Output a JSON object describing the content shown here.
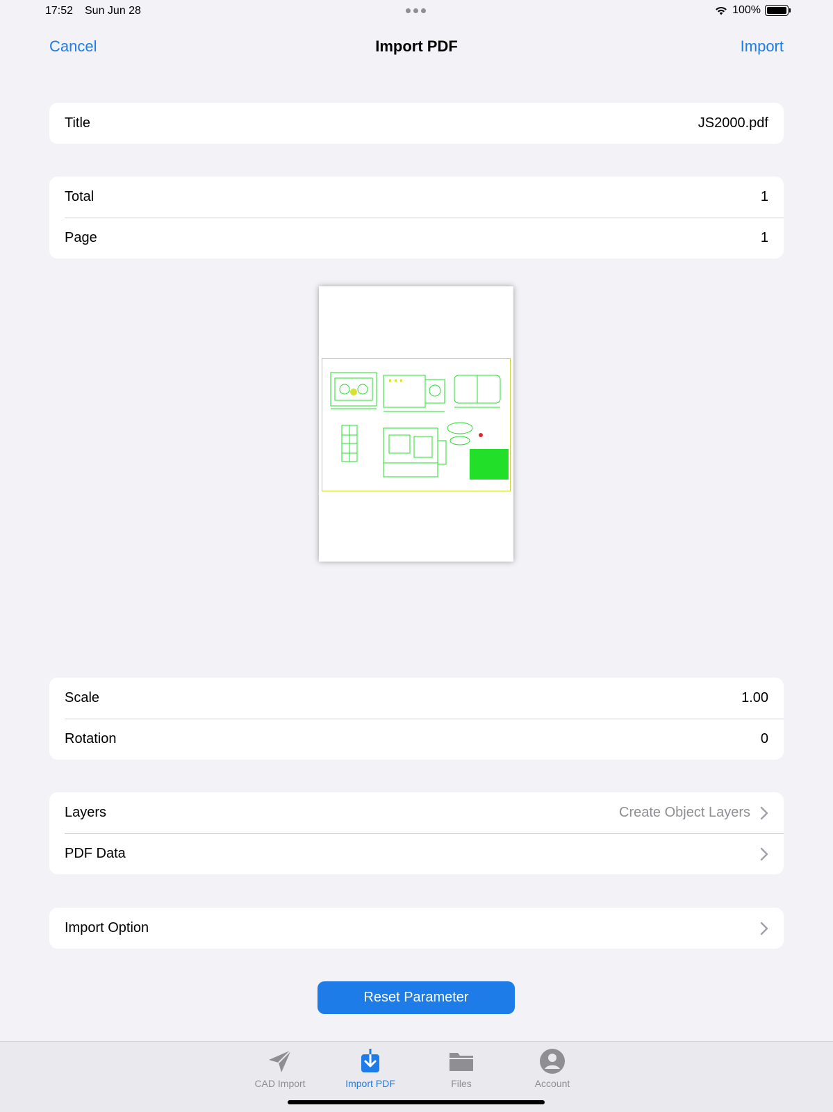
{
  "status": {
    "time": "17:52",
    "date": "Sun Jun 28",
    "battery_percent": "100%",
    "battery_level": 1.0
  },
  "nav": {
    "cancel_label": "Cancel",
    "title": "Import PDF",
    "import_label": "Import"
  },
  "file": {
    "title_label": "Title",
    "title_value": "JS2000.pdf"
  },
  "pages": {
    "total_label": "Total",
    "total_value": "1",
    "page_label": "Page",
    "page_value": "1"
  },
  "transform": {
    "scale_label": "Scale",
    "scale_value": "1.00",
    "rotation_label": "Rotation",
    "rotation_value": "0"
  },
  "data_options": {
    "layers_label": "Layers",
    "layers_value": "Create Object Layers",
    "pdf_data_label": "PDF Data"
  },
  "import_options": {
    "label": "Import Option"
  },
  "reset_label": "Reset Parameter",
  "tabs": [
    {
      "label": "CAD Import",
      "icon": "paper-plane-icon",
      "active": false
    },
    {
      "label": "Import PDF",
      "icon": "download-tray-icon",
      "active": true
    },
    {
      "label": "Files",
      "icon": "folder-icon",
      "active": false
    },
    {
      "label": "Account",
      "icon": "person-circle-icon",
      "active": false
    }
  ],
  "colors": {
    "accent": "#1e7ce8",
    "background": "#f2f2f7",
    "drawing_green": "#22e02a",
    "drawing_yellow": "#d8e030"
  }
}
